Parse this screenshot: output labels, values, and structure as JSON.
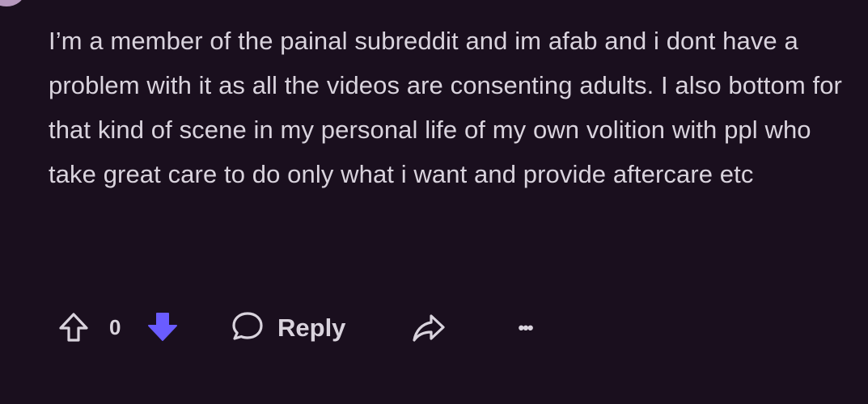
{
  "comment": {
    "text": "I’m a member of the painal subreddit and im afab and i dont have a problem with it as all the videos are consenting adults. I also bottom for that kind of scene in my personal life of my own volition with ppl who take great care to do only what i want and provide aftercare etc"
  },
  "actions": {
    "upvote_icon": "arrow-up-outline-icon",
    "vote_count": "0",
    "downvote_icon": "arrow-down-filled-icon",
    "downvote_active": true,
    "reply_icon": "speech-bubble-icon",
    "reply_label": "Reply",
    "share_icon": "share-arrow-icon",
    "more_icon": "ellipsis-icon",
    "more_label": "•••"
  },
  "colors": {
    "background": "#1a0f1e",
    "text": "#d9d3dd",
    "downvote_accent": "#6a5cff"
  }
}
